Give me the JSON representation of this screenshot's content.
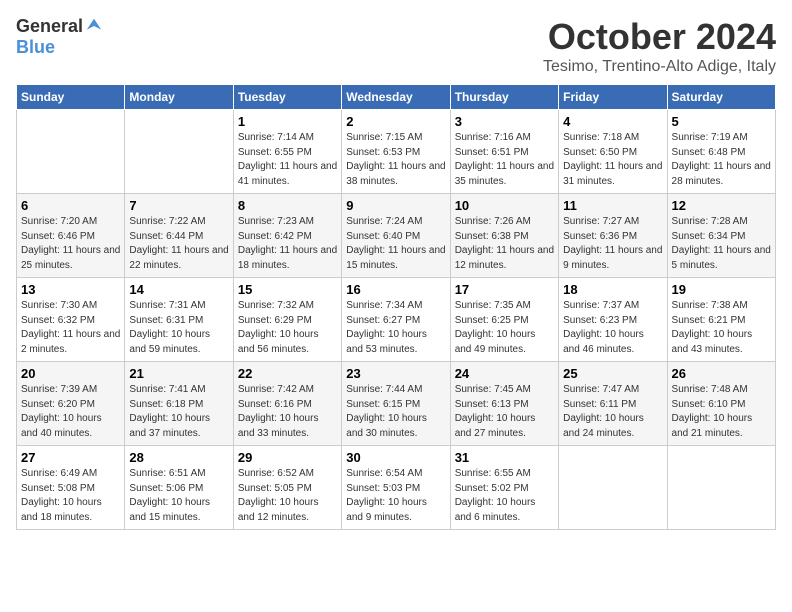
{
  "logo": {
    "general": "General",
    "blue": "Blue"
  },
  "title": "October 2024",
  "subtitle": "Tesimo, Trentino-Alto Adige, Italy",
  "days_of_week": [
    "Sunday",
    "Monday",
    "Tuesday",
    "Wednesday",
    "Thursday",
    "Friday",
    "Saturday"
  ],
  "weeks": [
    [
      {
        "day": "",
        "sunrise": "",
        "sunset": "",
        "daylight": ""
      },
      {
        "day": "",
        "sunrise": "",
        "sunset": "",
        "daylight": ""
      },
      {
        "day": "1",
        "sunrise": "Sunrise: 7:14 AM",
        "sunset": "Sunset: 6:55 PM",
        "daylight": "Daylight: 11 hours and 41 minutes."
      },
      {
        "day": "2",
        "sunrise": "Sunrise: 7:15 AM",
        "sunset": "Sunset: 6:53 PM",
        "daylight": "Daylight: 11 hours and 38 minutes."
      },
      {
        "day": "3",
        "sunrise": "Sunrise: 7:16 AM",
        "sunset": "Sunset: 6:51 PM",
        "daylight": "Daylight: 11 hours and 35 minutes."
      },
      {
        "day": "4",
        "sunrise": "Sunrise: 7:18 AM",
        "sunset": "Sunset: 6:50 PM",
        "daylight": "Daylight: 11 hours and 31 minutes."
      },
      {
        "day": "5",
        "sunrise": "Sunrise: 7:19 AM",
        "sunset": "Sunset: 6:48 PM",
        "daylight": "Daylight: 11 hours and 28 minutes."
      }
    ],
    [
      {
        "day": "6",
        "sunrise": "Sunrise: 7:20 AM",
        "sunset": "Sunset: 6:46 PM",
        "daylight": "Daylight: 11 hours and 25 minutes."
      },
      {
        "day": "7",
        "sunrise": "Sunrise: 7:22 AM",
        "sunset": "Sunset: 6:44 PM",
        "daylight": "Daylight: 11 hours and 22 minutes."
      },
      {
        "day": "8",
        "sunrise": "Sunrise: 7:23 AM",
        "sunset": "Sunset: 6:42 PM",
        "daylight": "Daylight: 11 hours and 18 minutes."
      },
      {
        "day": "9",
        "sunrise": "Sunrise: 7:24 AM",
        "sunset": "Sunset: 6:40 PM",
        "daylight": "Daylight: 11 hours and 15 minutes."
      },
      {
        "day": "10",
        "sunrise": "Sunrise: 7:26 AM",
        "sunset": "Sunset: 6:38 PM",
        "daylight": "Daylight: 11 hours and 12 minutes."
      },
      {
        "day": "11",
        "sunrise": "Sunrise: 7:27 AM",
        "sunset": "Sunset: 6:36 PM",
        "daylight": "Daylight: 11 hours and 9 minutes."
      },
      {
        "day": "12",
        "sunrise": "Sunrise: 7:28 AM",
        "sunset": "Sunset: 6:34 PM",
        "daylight": "Daylight: 11 hours and 5 minutes."
      }
    ],
    [
      {
        "day": "13",
        "sunrise": "Sunrise: 7:30 AM",
        "sunset": "Sunset: 6:32 PM",
        "daylight": "Daylight: 11 hours and 2 minutes."
      },
      {
        "day": "14",
        "sunrise": "Sunrise: 7:31 AM",
        "sunset": "Sunset: 6:31 PM",
        "daylight": "Daylight: 10 hours and 59 minutes."
      },
      {
        "day": "15",
        "sunrise": "Sunrise: 7:32 AM",
        "sunset": "Sunset: 6:29 PM",
        "daylight": "Daylight: 10 hours and 56 minutes."
      },
      {
        "day": "16",
        "sunrise": "Sunrise: 7:34 AM",
        "sunset": "Sunset: 6:27 PM",
        "daylight": "Daylight: 10 hours and 53 minutes."
      },
      {
        "day": "17",
        "sunrise": "Sunrise: 7:35 AM",
        "sunset": "Sunset: 6:25 PM",
        "daylight": "Daylight: 10 hours and 49 minutes."
      },
      {
        "day": "18",
        "sunrise": "Sunrise: 7:37 AM",
        "sunset": "Sunset: 6:23 PM",
        "daylight": "Daylight: 10 hours and 46 minutes."
      },
      {
        "day": "19",
        "sunrise": "Sunrise: 7:38 AM",
        "sunset": "Sunset: 6:21 PM",
        "daylight": "Daylight: 10 hours and 43 minutes."
      }
    ],
    [
      {
        "day": "20",
        "sunrise": "Sunrise: 7:39 AM",
        "sunset": "Sunset: 6:20 PM",
        "daylight": "Daylight: 10 hours and 40 minutes."
      },
      {
        "day": "21",
        "sunrise": "Sunrise: 7:41 AM",
        "sunset": "Sunset: 6:18 PM",
        "daylight": "Daylight: 10 hours and 37 minutes."
      },
      {
        "day": "22",
        "sunrise": "Sunrise: 7:42 AM",
        "sunset": "Sunset: 6:16 PM",
        "daylight": "Daylight: 10 hours and 33 minutes."
      },
      {
        "day": "23",
        "sunrise": "Sunrise: 7:44 AM",
        "sunset": "Sunset: 6:15 PM",
        "daylight": "Daylight: 10 hours and 30 minutes."
      },
      {
        "day": "24",
        "sunrise": "Sunrise: 7:45 AM",
        "sunset": "Sunset: 6:13 PM",
        "daylight": "Daylight: 10 hours and 27 minutes."
      },
      {
        "day": "25",
        "sunrise": "Sunrise: 7:47 AM",
        "sunset": "Sunset: 6:11 PM",
        "daylight": "Daylight: 10 hours and 24 minutes."
      },
      {
        "day": "26",
        "sunrise": "Sunrise: 7:48 AM",
        "sunset": "Sunset: 6:10 PM",
        "daylight": "Daylight: 10 hours and 21 minutes."
      }
    ],
    [
      {
        "day": "27",
        "sunrise": "Sunrise: 6:49 AM",
        "sunset": "Sunset: 5:08 PM",
        "daylight": "Daylight: 10 hours and 18 minutes."
      },
      {
        "day": "28",
        "sunrise": "Sunrise: 6:51 AM",
        "sunset": "Sunset: 5:06 PM",
        "daylight": "Daylight: 10 hours and 15 minutes."
      },
      {
        "day": "29",
        "sunrise": "Sunrise: 6:52 AM",
        "sunset": "Sunset: 5:05 PM",
        "daylight": "Daylight: 10 hours and 12 minutes."
      },
      {
        "day": "30",
        "sunrise": "Sunrise: 6:54 AM",
        "sunset": "Sunset: 5:03 PM",
        "daylight": "Daylight: 10 hours and 9 minutes."
      },
      {
        "day": "31",
        "sunrise": "Sunrise: 6:55 AM",
        "sunset": "Sunset: 5:02 PM",
        "daylight": "Daylight: 10 hours and 6 minutes."
      },
      {
        "day": "",
        "sunrise": "",
        "sunset": "",
        "daylight": ""
      },
      {
        "day": "",
        "sunrise": "",
        "sunset": "",
        "daylight": ""
      }
    ]
  ]
}
